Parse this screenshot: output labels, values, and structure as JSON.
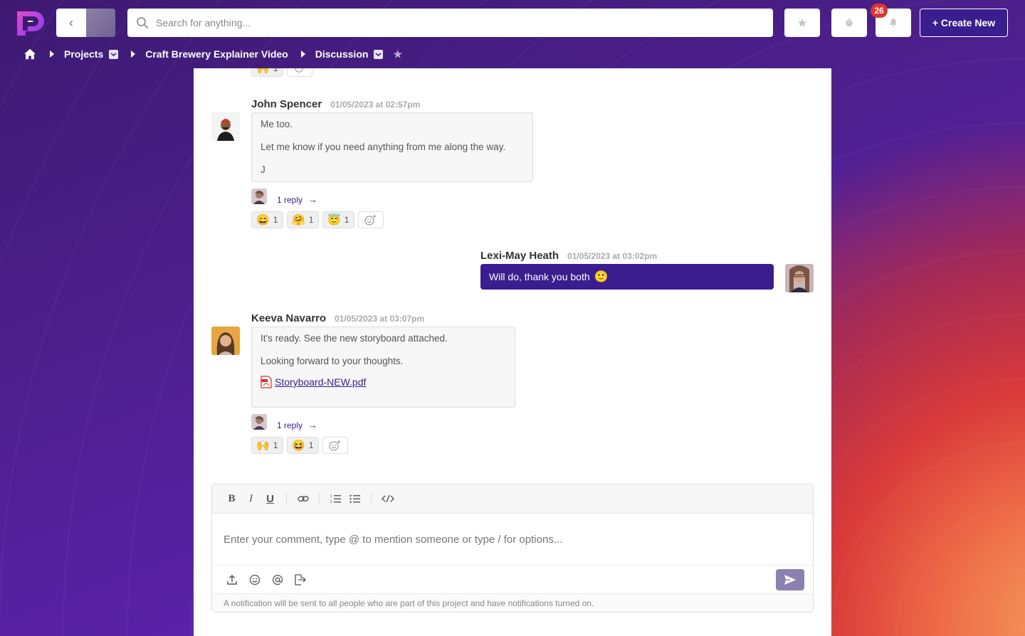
{
  "topbar": {
    "search_placeholder": "Search for anything...",
    "notifications_count": "26",
    "create_label": "+ Create New"
  },
  "breadcrumb": {
    "projects": "Projects",
    "project": "Craft Brewery Explainer Video",
    "section": "Discussion"
  },
  "messages": [
    {
      "author": "John Spencer",
      "time": "01/05/2023 at 02:57pm",
      "lines": [
        "Me too.",
        "Let me know if you need anything from me along the way.",
        "J"
      ],
      "reply_label": "1 reply",
      "reactions": [
        {
          "emoji": "😄",
          "count": "1"
        },
        {
          "emoji": "🤗",
          "count": "1"
        },
        {
          "emoji": "😇",
          "count": "1"
        }
      ]
    },
    {
      "author": "Lexi-May Heath",
      "time": "01/05/2023 at 03:02pm",
      "text": "Will do, thank you both",
      "emoji": "🙂"
    },
    {
      "author": "Keeva Navarro",
      "time": "01/05/2023 at 03:07pm",
      "lines": [
        "It's ready. See the new storyboard attached.",
        "Looking forward to your thoughts."
      ],
      "attachment": "Storyboard-NEW.pdf",
      "reply_label": "1 reply",
      "reactions": [
        {
          "emoji": "🙌",
          "count": "1"
        },
        {
          "emoji": "😆",
          "count": "1"
        }
      ]
    }
  ],
  "top_reaction": {
    "emoji": "🙌",
    "count": "1"
  },
  "composer": {
    "placeholder": "Enter your comment, type @ to mention someone or type / for options...",
    "note": "A notification will be sent to all people who are part of this project and have notifications turned on."
  },
  "colors": {
    "accent": "#3a1d8e",
    "badge": "#e0342f"
  }
}
